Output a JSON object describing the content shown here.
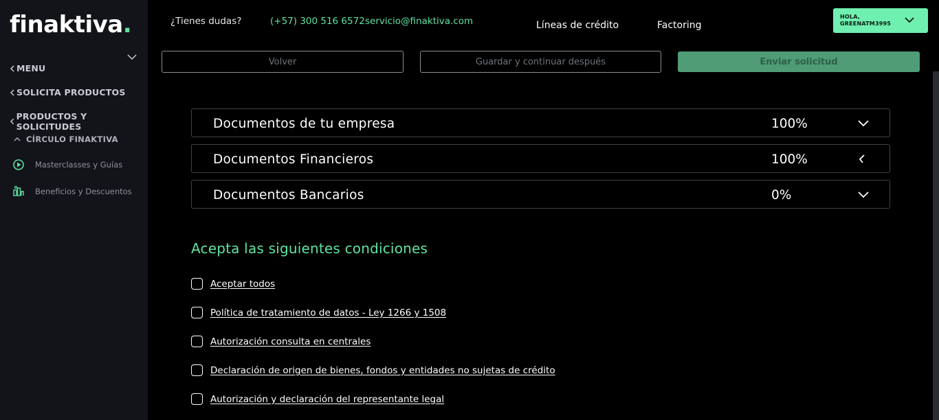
{
  "brand": {
    "name": "finaktiva",
    "dot": "."
  },
  "sidebar": {
    "menu": "MENU",
    "solicita": "SOLICITA PRODUCTOS",
    "productos": "PRODUCTOS Y SOLICITUDES",
    "circulo": "CÍRCULO FINAKTIVA",
    "items": [
      {
        "label": "Masterclasses y Guías",
        "icon": "play-circle-icon"
      },
      {
        "label": "Beneficios y Descuentos",
        "icon": "benefits-icon"
      }
    ]
  },
  "header": {
    "dudas": "¿Tienes dudas?",
    "phone": "(+57) 300 516 6572",
    "email": "servicio@finaktiva.com",
    "nav": [
      "Líneas de crédito",
      "Factoring"
    ],
    "user": {
      "greeting": "HOLA,",
      "name": "GREENATM3995"
    }
  },
  "actions": {
    "back": "Volver",
    "save": "Guardar y continuar después",
    "send": "Enviar solicitud"
  },
  "sections": [
    {
      "title": "Documentos de tu empresa",
      "percent": "100%",
      "state": "collapsed"
    },
    {
      "title": "Documentos Financieros",
      "percent": "100%",
      "state": "loading"
    },
    {
      "title": "Documentos Bancarios",
      "percent": "0%",
      "state": "collapsed"
    }
  ],
  "conditions": {
    "title": "Acepta las siguientes condiciones",
    "items": [
      {
        "label": "Aceptar todos",
        "checked": false
      },
      {
        "label": "Política de tratamiento de datos - Ley 1266 y 1508",
        "checked": false
      },
      {
        "label": "Autorización consulta en centrales",
        "checked": false
      },
      {
        "label": "Declaración de origen de bienes, fondos y entidades no sujetas de crédito",
        "checked": false
      },
      {
        "label": "Autorización y declaración del representante legal",
        "checked": false
      }
    ]
  },
  "colors": {
    "accent": "#5fe3a1",
    "user_box": "#6ff0b0",
    "send_button": "#4f9c76",
    "sidebar": "#121419"
  }
}
